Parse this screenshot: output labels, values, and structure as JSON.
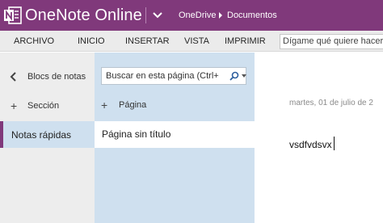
{
  "app": {
    "title": "OneNote Online",
    "brand_color": "#80397b",
    "logo_icon": "onenote-logo-icon"
  },
  "breadcrumb": {
    "items": [
      "OneDrive",
      "Documentos"
    ]
  },
  "ribbon": {
    "tabs": [
      "ARCHIVO",
      "INICIO",
      "INSERTAR",
      "VISTA",
      "IMPRIMIR"
    ],
    "tell_me_placeholder": "Dígame qué quiere hacer"
  },
  "nav": {
    "back_label": "Blocs de notas",
    "add_section_label": "Sección",
    "sections": [
      {
        "label": "Notas rápidas",
        "active": true
      }
    ]
  },
  "pages": {
    "search_placeholder": "Buscar en esta página (Ctrl+",
    "add_page_label": "Página",
    "items": [
      {
        "label": "Página sin título",
        "selected": true
      }
    ]
  },
  "canvas": {
    "date": "martes, 01 de julio de 2",
    "note_text": "vsdfvdsvx"
  }
}
